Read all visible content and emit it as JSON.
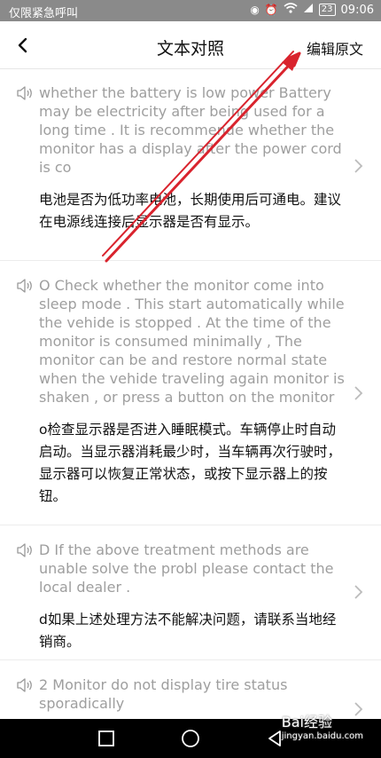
{
  "status_bar": {
    "left_text": "仅限紧急呼叫",
    "battery": "23",
    "time": "09:06"
  },
  "header": {
    "title": "文本对照",
    "edit_label": "编辑原文"
  },
  "items": [
    {
      "source": "whether the battery is low power Battery may be electricity after being used for a long time . It is recommende whether the monitor has a display after the power cord is co",
      "translation": "电池是否为低功率电池，长期使用后可通电。建议在电源线连接后显示器是否有显示。"
    },
    {
      "source": "O Check whether the monitor come into sleep mode . This start automatically while the vehide is stopped . At the time of the monitor is consumed minimally , The monitor can be and restore normal state when the vehide traveling again monitor is shaken , or press a button on the monitor",
      "translation": "o检查显示器是否进入睡眠模式。车辆停止时自动启动。当显示器消耗最少时，当车辆再次行驶时，显示器可以恢复正常状态，或按下显示器上的按钮。"
    },
    {
      "source": "D If the above treatment methods are unable solve the probl please contact the local dealer .",
      "translation": "d如果上述处理方法不能解决问题，请联系当地经销商。"
    },
    {
      "source": "2 Monitor do not display tire status sporadically",
      "translation": ""
    }
  ],
  "watermark": {
    "brand": "Bai经验",
    "url": "jingyan.baidu.com"
  },
  "colors": {
    "annotation_arrow": "#d9232d",
    "source_text": "#9e9e9e",
    "status_bar": "#8a8a8a"
  }
}
